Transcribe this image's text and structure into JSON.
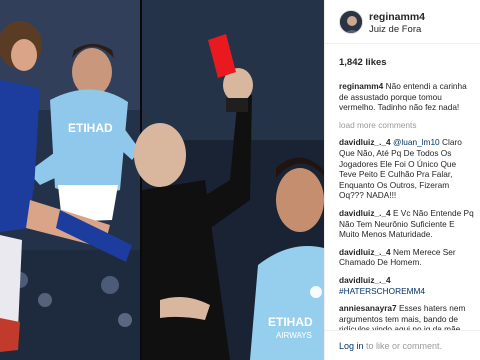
{
  "post": {
    "image": {
      "left_panel_colors": {
        "city_blue": "#8fc8ea",
        "city_shorts": "#ffffff",
        "chelsea_blue": "#1c3c9e",
        "crowd": "#2a3a55"
      },
      "right_panel_colors": {
        "referee_black": "#101010",
        "card_red": "#e8191f",
        "city_blue": "#96cfee"
      },
      "shirt_text": "ETIHAD",
      "shirt_subtext": "AIRWAYS"
    },
    "header": {
      "username": "reginamm4",
      "location": "Juiz de Fora"
    },
    "likes_text": "1,842 likes",
    "caption": {
      "author": "reginamm4",
      "text": "Não entendi a carinha de assustado porque tomou vermelho. Tadinho não fez nada!"
    },
    "load_more": "load more comments",
    "comments": [
      {
        "author": "davidluiz_._4",
        "mention": "@luan_lm10",
        "text": "Claro Que Não, Até Pq De Todos Os Jogadores Ele Foi O Único Que Teve Peito E Culhão Pra Falar, Enquanto Os Outros, Fizeram Oq??? NADA!!!"
      },
      {
        "author": "davidluiz_._4",
        "mention": "",
        "text": "E Vc Não Entende Pq Não Tem Neurônio Suficiente E Muito Menos Maturidade."
      },
      {
        "author": "davidluiz_._4",
        "mention": "",
        "text": "Nem Merece Ser Chamado De Homem."
      },
      {
        "author": "davidluiz_._4",
        "mention": "#HATERSCHOREMM4",
        "text": ""
      },
      {
        "author": "anniesanayra7",
        "mention": "",
        "text": "Esses haters nem argumentos tem mais, bando de ridículos vindo aqui no ig da mãe dele falar merd@, parem que tá micão demais!!!"
      }
    ],
    "footer": {
      "login_label": "Log in",
      "rest": " to like or comment."
    }
  }
}
